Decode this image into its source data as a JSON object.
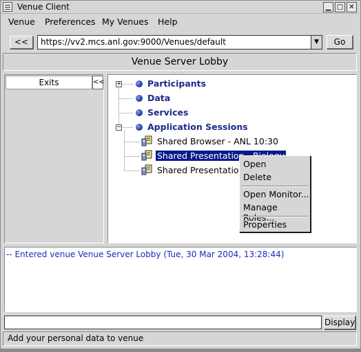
{
  "window": {
    "title": "Venue Client"
  },
  "menubar": {
    "items": [
      "Venue",
      "Preferences",
      "My Venues",
      "Help"
    ]
  },
  "toolbar": {
    "back_label": "<<",
    "url_value": "https://vv2.mcs.anl.gov:9000/Venues/default",
    "dropdown_glyph": "▼",
    "go_label": "Go"
  },
  "venue": {
    "name": "Venue Server Lobby"
  },
  "exits": {
    "header": "Exits",
    "collapse_label": "<<"
  },
  "tree": {
    "participants": "Participants",
    "data": "Data",
    "services": "Services",
    "app_sessions": "Application Sessions",
    "sessions": [
      "Shared Browser - ANL 10:30",
      "Shared Presentation - Biology",
      "Shared Presentation -"
    ]
  },
  "context_menu": {
    "open": "Open",
    "delete": "Delete",
    "open_monitor": "Open Monitor...",
    "manage_roles": "Manage Roles...",
    "properties": "Properties"
  },
  "log": {
    "line": "-- Entered venue Venue Server Lobby (Tue, 30 Mar 2004, 13:28:44)"
  },
  "input": {
    "value": "",
    "display_label": "Display"
  },
  "status": {
    "text": "Add your personal data to venue"
  },
  "colors": {
    "selection": "#0a1a8c",
    "tree_label": "#1a2a8a",
    "log_text": "#1a2ab8"
  }
}
